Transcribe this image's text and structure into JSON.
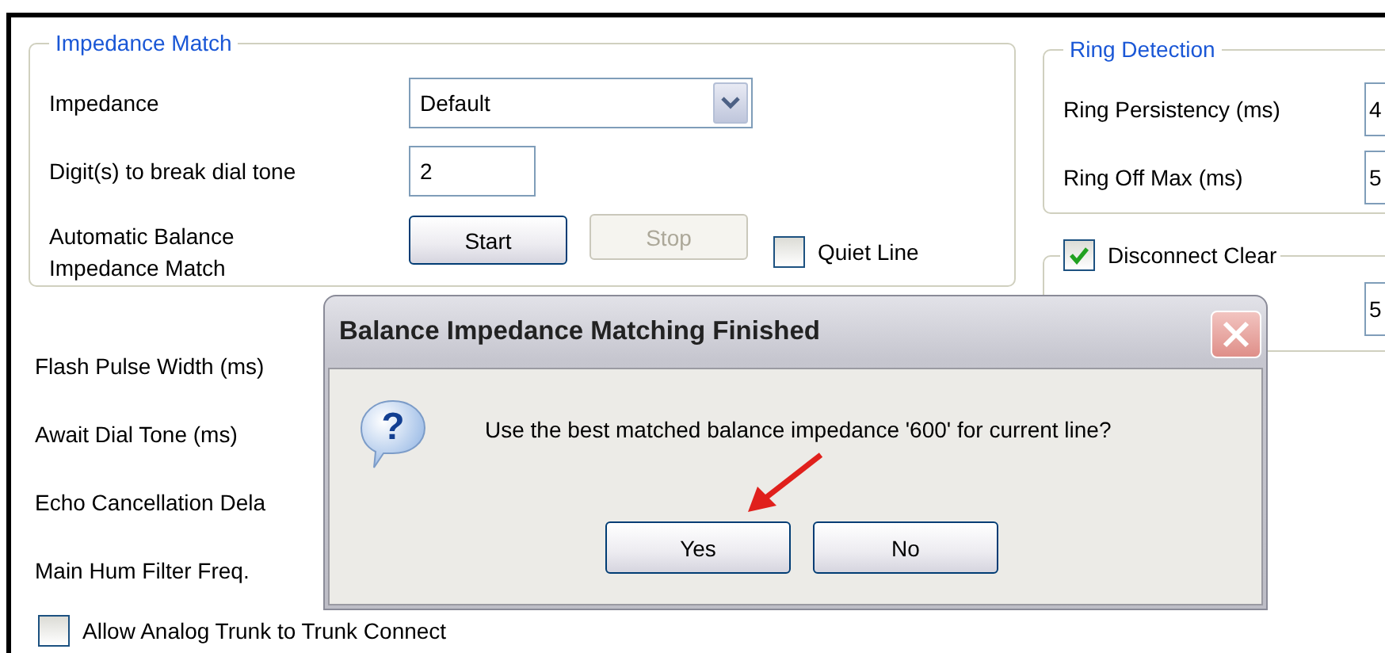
{
  "impedance_match": {
    "title": "Impedance Match",
    "impedance": {
      "label": "Impedance",
      "value": "Default"
    },
    "digits": {
      "label": "Digit(s) to break dial tone",
      "value": "2"
    },
    "auto_balance": {
      "label": "Automatic Balance Impedance Match",
      "buttons": [
        {
          "label": "Start",
          "disabled": false
        },
        {
          "label": "Stop",
          "disabled": true
        }
      ],
      "quiet_line": {
        "label": "Quiet Line",
        "checked": false
      }
    }
  },
  "settings": [
    {
      "label": "Flash Pulse Width (ms)"
    },
    {
      "label": "Await Dial Tone (ms)"
    },
    {
      "label": "Echo Cancellation Dela"
    },
    {
      "label": "Main Hum Filter Freq."
    }
  ],
  "allow_trunk": {
    "label": "Allow Analog Trunk to Trunk Connect",
    "checked": false
  },
  "ring_detection": {
    "title": "Ring Detection",
    "rows": [
      {
        "label": "Ring Persistency (ms)",
        "value": "4"
      },
      {
        "label": "Ring Off Max (ms)",
        "value": "5"
      }
    ]
  },
  "disconnect_clear": {
    "label": "Disconnect Clear",
    "checked": true,
    "value": "5"
  },
  "dialog": {
    "title": "Balance Impedance Matching Finished",
    "icon_glyph": "?",
    "message": "Use the best matched balance impedance '600' for current line?",
    "buttons": [
      {
        "label": "Yes"
      },
      {
        "label": "No"
      }
    ]
  }
}
